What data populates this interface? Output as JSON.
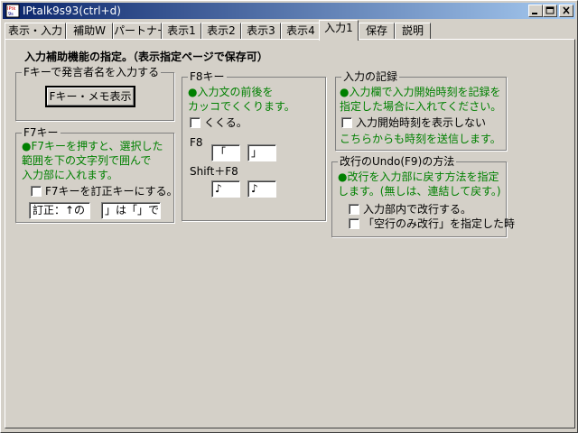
{
  "window": {
    "title": "IPtalk9s93(ctrl+d)"
  },
  "tabs": [
    {
      "label": "表示・入力"
    },
    {
      "label": "補助W"
    },
    {
      "label": "パートナー"
    },
    {
      "label": "表示1"
    },
    {
      "label": "表示2"
    },
    {
      "label": "表示3"
    },
    {
      "label": "表示4"
    },
    {
      "label": "入力1"
    },
    {
      "label": "保存"
    },
    {
      "label": "説明"
    }
  ],
  "heading": "入力補助機能の指定。（表示指定ページで保存可）",
  "fkey_group": {
    "legend": "Fキーで発言者名を入力する",
    "button": "Fキー・メモ表示"
  },
  "f7_group": {
    "legend": "F7キー",
    "desc1": "●F7キーを押すと、選択した",
    "desc2": "範囲を下の文字列で囲んで",
    "desc3": "入力部に入れます。",
    "checkbox": "F7キーを訂正キーにする。",
    "field1": "訂正：↑の「",
    "field2": "」は「」です。"
  },
  "f8_group": {
    "legend": "F8キー",
    "desc1": "●入力文の前後を",
    "desc2": "カッコでくくります。",
    "checkbox": "くくる。",
    "f8_label": "F8",
    "f8_open": "「",
    "f8_close": "」",
    "shift_label": "Shift＋F8",
    "shift_open": "♪",
    "shift_close": "♪"
  },
  "record_group": {
    "legend": "入力の記録",
    "desc1": "●入力欄で入力開始時刻を記録を",
    "desc2": "指定した場合に入れてください。",
    "checkbox": "入力開始時刻を表示しない",
    "note": "こちらからも時刻を送信します。"
  },
  "undo_group": {
    "legend": "改行のUndo(F9)の方法",
    "desc1": "●改行を入力部に戻す方法を指定",
    "desc2": "します。(無しは、連結して戻す。)",
    "checkbox1": "入力部内で改行する。",
    "checkbox2": "「空行のみ改行」を指定した時"
  },
  "colors": {
    "green_text": "#008000",
    "title_start": "#0a246a",
    "title_end": "#a6caf0"
  }
}
